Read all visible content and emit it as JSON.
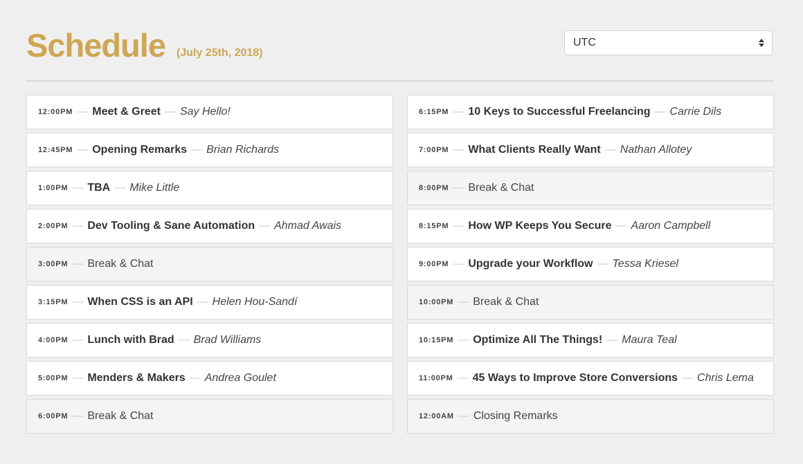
{
  "header": {
    "title": "Schedule",
    "date": "(July 25th, 2018)",
    "timezone": "UTC",
    "timezone_arrows": "⬍"
  },
  "colors": {
    "accent": "#cfa655",
    "background": "#efefef",
    "row_background": "#ffffff",
    "break_background": "#f4f4f4"
  },
  "schedule": {
    "left": [
      {
        "time": "12:00PM",
        "title": "Meet & Greet",
        "speaker": "Say Hello!",
        "is_break": false
      },
      {
        "time": "12:45PM",
        "title": "Opening Remarks",
        "speaker": "Brian Richards",
        "is_break": false
      },
      {
        "time": "1:00PM",
        "title": "TBA",
        "speaker": "Mike Little",
        "is_break": false
      },
      {
        "time": "2:00PM",
        "title": "Dev Tooling & Sane Automation",
        "speaker": "Ahmad Awais",
        "is_break": false
      },
      {
        "time": "3:00PM",
        "title": "Break & Chat",
        "speaker": "",
        "is_break": true
      },
      {
        "time": "3:15PM",
        "title": "When CSS is an API",
        "speaker": "Helen Hou-Sandí",
        "is_break": false
      },
      {
        "time": "4:00PM",
        "title": "Lunch with Brad",
        "speaker": "Brad Williams",
        "is_break": false
      },
      {
        "time": "5:00PM",
        "title": "Menders & Makers",
        "speaker": "Andrea Goulet",
        "is_break": false
      },
      {
        "time": "6:00PM",
        "title": "Break & Chat",
        "speaker": "",
        "is_break": true
      }
    ],
    "right": [
      {
        "time": "6:15PM",
        "title": "10 Keys to Successful Freelancing",
        "speaker": "Carrie Dils",
        "is_break": false
      },
      {
        "time": "7:00PM",
        "title": "What Clients Really Want",
        "speaker": "Nathan Allotey",
        "is_break": false
      },
      {
        "time": "8:00PM",
        "title": "Break & Chat",
        "speaker": "",
        "is_break": true
      },
      {
        "time": "8:15PM",
        "title": "How WP Keeps You Secure",
        "speaker": "Aaron Campbell",
        "is_break": false
      },
      {
        "time": "9:00PM",
        "title": "Upgrade your Workflow",
        "speaker": "Tessa Kriesel",
        "is_break": false
      },
      {
        "time": "10:00PM",
        "title": "Break & Chat",
        "speaker": "",
        "is_break": true
      },
      {
        "time": "10:15PM",
        "title": "Optimize All The Things!",
        "speaker": "Maura Teal",
        "is_break": false
      },
      {
        "time": "11:00PM",
        "title": "45 Ways to Improve Store Conversions",
        "speaker": "Chris Lema",
        "is_break": false
      },
      {
        "time": "12:00AM",
        "title": "Closing Remarks",
        "speaker": "",
        "is_break": true
      }
    ]
  }
}
